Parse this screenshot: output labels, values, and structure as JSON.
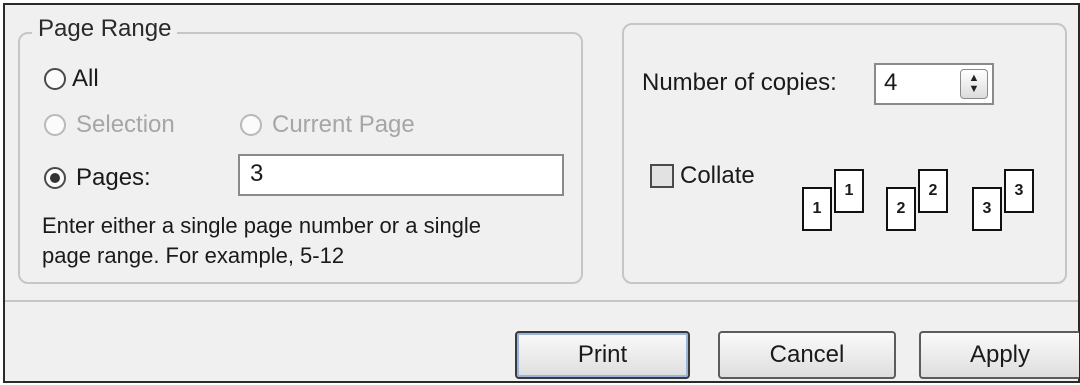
{
  "page_range": {
    "title": "Page Range",
    "all_label": "All",
    "selection_label": "Selection",
    "current_page_label": "Current Page",
    "pages_label": "Pages:",
    "pages_value": "3",
    "hint_line1": "Enter either a single page number or a single",
    "hint_line2": "page range.  For example, 5-12",
    "selected": "pages"
  },
  "copies": {
    "label": "Number of copies:",
    "value": "4",
    "collate_label": "Collate",
    "collate_checked": false,
    "icon_pages": [
      "1",
      "1",
      "2",
      "2",
      "3",
      "3"
    ]
  },
  "buttons": {
    "print": "Print",
    "cancel": "Cancel",
    "apply": "Apply"
  }
}
